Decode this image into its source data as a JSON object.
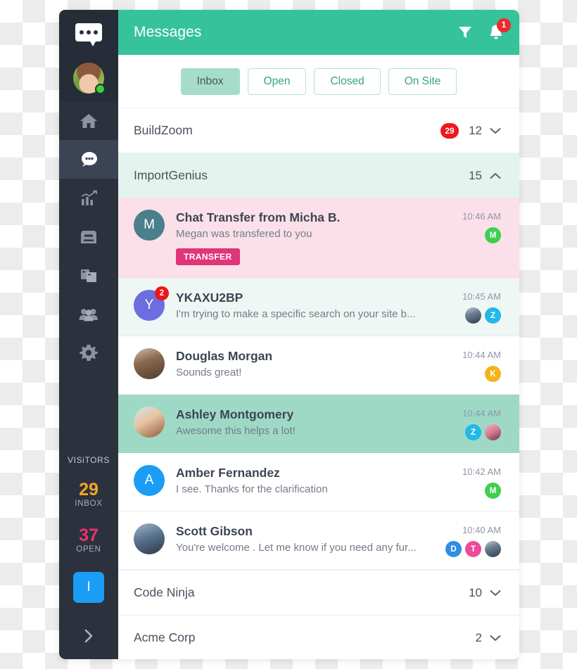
{
  "sidebar": {
    "logo_icon": "chat-bubble-logo",
    "user_avatar_name": "current-user-avatar",
    "status": "online",
    "nav": [
      {
        "icon": "home-icon",
        "label": "Home",
        "active": false
      },
      {
        "icon": "chat-icon",
        "label": "Messages",
        "active": true
      },
      {
        "icon": "chart-icon",
        "label": "Analytics",
        "active": false
      },
      {
        "icon": "inbox-tray-icon",
        "label": "Archive",
        "active": false
      },
      {
        "icon": "copy-icon",
        "label": "Canned",
        "active": false
      },
      {
        "icon": "people-icon",
        "label": "Team",
        "active": false
      },
      {
        "icon": "gear-icon",
        "label": "Settings",
        "active": false
      }
    ],
    "visitors_title": "VISiTORS",
    "stats": [
      {
        "value": "29",
        "label": "INBOX",
        "color": "#f5a623"
      },
      {
        "value": "37",
        "label": "OPEN",
        "color": "#e8336d"
      }
    ],
    "action_button_label": "I",
    "action_button_color": "#1b9df5",
    "expand_icon": "chevron-right-icon"
  },
  "topbar": {
    "title": "Messages",
    "filter_icon": "filter-icon",
    "bell_icon": "bell-icon",
    "notification_count": "1",
    "accent_color": "#36c29b",
    "badge_color": "#f0292e"
  },
  "tabs": [
    {
      "label": "Inbox",
      "active": true
    },
    {
      "label": "Open",
      "active": false
    },
    {
      "label": "Closed",
      "active": false
    },
    {
      "label": "On Site",
      "active": false
    }
  ],
  "groups": [
    {
      "name": "BuildZoom",
      "badge": "29",
      "count": "12",
      "expanded": false,
      "chevron": "chevron-down-icon"
    },
    {
      "name": "ImportGenius",
      "badge": "",
      "count": "15",
      "expanded": true,
      "chevron": "chevron-up-icon"
    },
    {
      "name": "Code Ninja",
      "badge": "",
      "count": "10",
      "expanded": false,
      "chevron": "chevron-down-icon"
    },
    {
      "name": "Acme Corp",
      "badge": "",
      "count": "2",
      "expanded": false,
      "chevron": "chevron-down-icon"
    }
  ],
  "conversations": [
    {
      "name": "Chat Transfer from Micha B.",
      "preview": "Megan was transfered to you",
      "time": "10:46 AM",
      "row_style": "pink",
      "tag": "TRANSFER",
      "tag_color": "#e0357a",
      "avatar": {
        "kind": "initial",
        "text": "M",
        "color": "#4a7f8c"
      },
      "unread": "",
      "participants": [
        {
          "kind": "initial",
          "text": "M",
          "color": "#3fcf50"
        }
      ]
    },
    {
      "name": "YKAXU2BP",
      "preview": "I'm trying to make a specific search on your site b...",
      "time": "10:45 AM",
      "row_style": "mint",
      "tag": "",
      "tag_color": "",
      "avatar": {
        "kind": "initial",
        "text": "Y",
        "color": "#6c6ee0"
      },
      "unread": "2",
      "participants": [
        {
          "kind": "photo",
          "text": "",
          "color": "photo-man2"
        },
        {
          "kind": "initial",
          "text": "Z",
          "color": "#22b8e8"
        }
      ]
    },
    {
      "name": "Douglas Morgan",
      "preview": "Sounds great!",
      "time": "10:44 AM",
      "row_style": "white",
      "tag": "",
      "tag_color": "",
      "avatar": {
        "kind": "photo",
        "text": "",
        "color": "photo-man1"
      },
      "unread": "",
      "participants": [
        {
          "kind": "initial",
          "text": "K",
          "color": "#f5b31b"
        }
      ]
    },
    {
      "name": "Ashley Montgomery",
      "preview": "Awesome this helps a lot!",
      "time": "10:44 AM",
      "row_style": "teal",
      "tag": "",
      "tag_color": "",
      "avatar": {
        "kind": "photo",
        "text": "",
        "color": "photo-woman"
      },
      "unread": "",
      "participants": [
        {
          "kind": "initial",
          "text": "Z",
          "color": "#22b8e8"
        },
        {
          "kind": "photo",
          "text": "",
          "color": "photo-woman2"
        }
      ]
    },
    {
      "name": "Amber Fernandez",
      "preview": "I see. Thanks for the clarification",
      "time": "10:42 AM",
      "row_style": "white",
      "tag": "",
      "tag_color": "",
      "avatar": {
        "kind": "initial",
        "text": "A",
        "color": "#1b9df5"
      },
      "unread": "",
      "participants": [
        {
          "kind": "initial",
          "text": "M",
          "color": "#3fcf50"
        }
      ]
    },
    {
      "name": "Scott Gibson",
      "preview": "You're welcome . Let me know if you need any fur...",
      "time": "10:40 AM",
      "row_style": "white",
      "tag": "",
      "tag_color": "",
      "avatar": {
        "kind": "photo",
        "text": "",
        "color": "photo-man3"
      },
      "unread": "",
      "participants": [
        {
          "kind": "initial",
          "text": "D",
          "color": "#2f8de4"
        },
        {
          "kind": "initial",
          "text": "T",
          "color": "#ec4c9b"
        },
        {
          "kind": "photo",
          "text": "",
          "color": "photo-man2"
        }
      ]
    }
  ]
}
